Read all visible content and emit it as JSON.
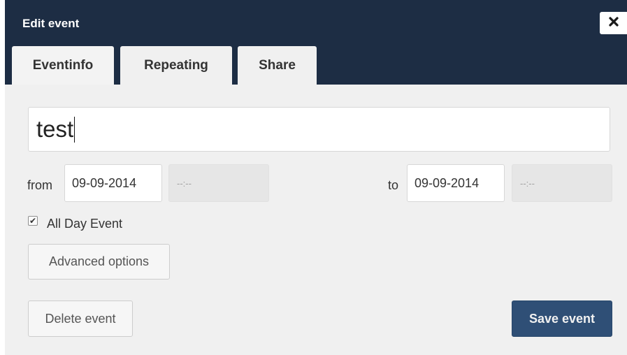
{
  "dialog": {
    "title": "Edit event",
    "close_icon": "close-icon"
  },
  "tabs": [
    {
      "label": "Eventinfo",
      "active": true
    },
    {
      "label": "Repeating",
      "active": false
    },
    {
      "label": "Share",
      "active": false
    }
  ],
  "event": {
    "title_value": "test",
    "from_label": "from",
    "to_label": "to",
    "from_date": "09-09-2014",
    "from_time": "--:--",
    "to_date": "09-09-2014",
    "to_time": "--:--",
    "all_day_label": "All Day Event",
    "all_day_checked": true
  },
  "buttons": {
    "advanced": "Advanced options",
    "delete": "Delete event",
    "save": "Save event"
  },
  "colors": {
    "header_bg": "#1d2d44",
    "body_bg": "#f0f0f0",
    "save_bg": "#2f4f76"
  }
}
